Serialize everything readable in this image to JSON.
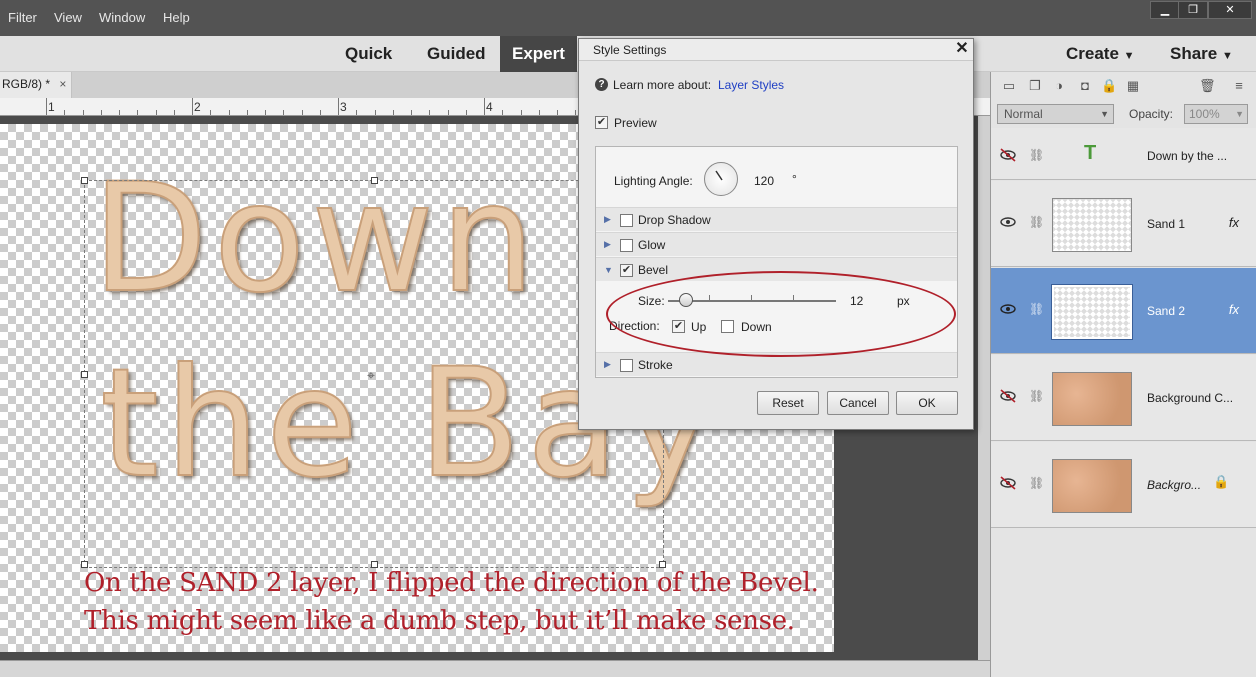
{
  "menubar": {
    "items": [
      "Filter",
      "View",
      "Window",
      "Help"
    ]
  },
  "window_controls": {
    "minimize": "▁",
    "restore": "❐",
    "close": "✕"
  },
  "modes": {
    "quick": "Quick",
    "guided": "Guided",
    "expert": "Expert",
    "create": "Create",
    "share": "Share"
  },
  "doc_tab": {
    "title": "RGB/8) *",
    "close": "×"
  },
  "ruler": {
    "labels": [
      "1",
      "2",
      "3",
      "4"
    ]
  },
  "canvas": {
    "line1": "Down b",
    "line2": "the Bay",
    "caption1": "On the SAND 2 layer, I flipped the direction of the Bevel.",
    "caption2": "This might seem like a dumb step, but it’ll make sense.",
    "accent_color": "#b0202a"
  },
  "dialog": {
    "title": "Style Settings",
    "close": "✕",
    "learn_prefix": "Learn more about:",
    "learn_link": "Layer Styles",
    "preview_label": "Preview",
    "preview_checked": true,
    "lighting_label": "Lighting Angle:",
    "lighting_value": "120",
    "lighting_unit": "°",
    "effects": [
      {
        "label": "Drop Shadow",
        "checked": false
      },
      {
        "label": "Glow",
        "checked": false
      },
      {
        "label": "Bevel",
        "checked": true
      },
      {
        "label": "Stroke",
        "checked": false
      }
    ],
    "size_label": "Size:",
    "size_value": "12",
    "size_unit": "px",
    "direction_label": "Direction:",
    "up_label": "Up",
    "up_checked": true,
    "down_label": "Down",
    "down_checked": false,
    "reset": "Reset",
    "cancel": "Cancel",
    "ok": "OK"
  },
  "layers_panel": {
    "blend_mode": "Normal",
    "opacity_label": "Opacity:",
    "opacity_value": "100%",
    "layers": [
      {
        "name": "Down by the ...",
        "type": "text",
        "visible": false
      },
      {
        "name": "Sand 1",
        "fx": "fx",
        "visible": true
      },
      {
        "name": "Sand 2",
        "fx": "fx",
        "visible": true,
        "selected": true
      },
      {
        "name": "Background C...",
        "visible": false
      },
      {
        "name": "Backgro...",
        "visible": false,
        "locked": true
      }
    ]
  }
}
